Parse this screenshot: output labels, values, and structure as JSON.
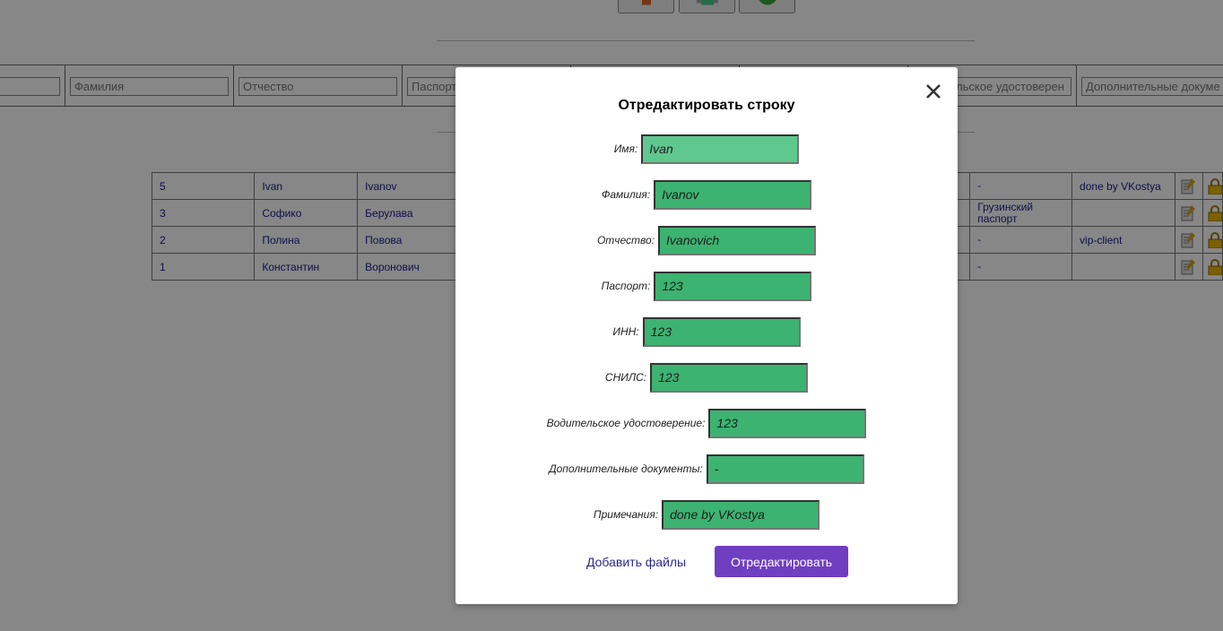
{
  "filters": {
    "placeholders": [
      "",
      "Фамилия",
      "Отчество",
      "Паспорт",
      "",
      "",
      "Водительское удостоверен",
      "Дополнительные докуме"
    ]
  },
  "table": {
    "rows": [
      {
        "id": "5",
        "name": "Ivan",
        "surname": "Ivanov",
        "license": "-",
        "notes": "done by VKostya"
      },
      {
        "id": "3",
        "name": "Софико",
        "surname": "Берулава",
        "license": "Грузинский паспорт",
        "notes": ""
      },
      {
        "id": "2",
        "name": "Полина",
        "surname": "Повова",
        "license": "-",
        "notes": "vip-client"
      },
      {
        "id": "1",
        "name": "Константин",
        "surname": "Воронович",
        "license": "-",
        "notes": ""
      }
    ]
  },
  "modal": {
    "title": "Отредактировать строку",
    "fields": [
      {
        "label": "Имя:",
        "value": "Ivan"
      },
      {
        "label": "Фамилия:",
        "value": "Ivanov"
      },
      {
        "label": "Отчество:",
        "value": "Ivanovich"
      },
      {
        "label": "Паспорт:",
        "value": "123"
      },
      {
        "label": "ИНН:",
        "value": "123"
      },
      {
        "label": "СНИЛС:",
        "value": "123"
      },
      {
        "label": "Водительское удостоверение:",
        "value": "123"
      },
      {
        "label": "Дополнительные документы:",
        "value": "-"
      },
      {
        "label": "Примечания:",
        "value": "done by VKostya"
      }
    ],
    "add_files_label": "Добавить файлы",
    "submit_label": "Отредактировать"
  },
  "colors": {
    "field_bg": "#3cb371",
    "field_focused_bg": "#5ec88e",
    "submit_bg": "#6f3ec1",
    "overlay": "rgba(0,0,0,0.47)"
  },
  "icons": [
    "close-icon",
    "edit-icon",
    "lock-icon"
  ]
}
